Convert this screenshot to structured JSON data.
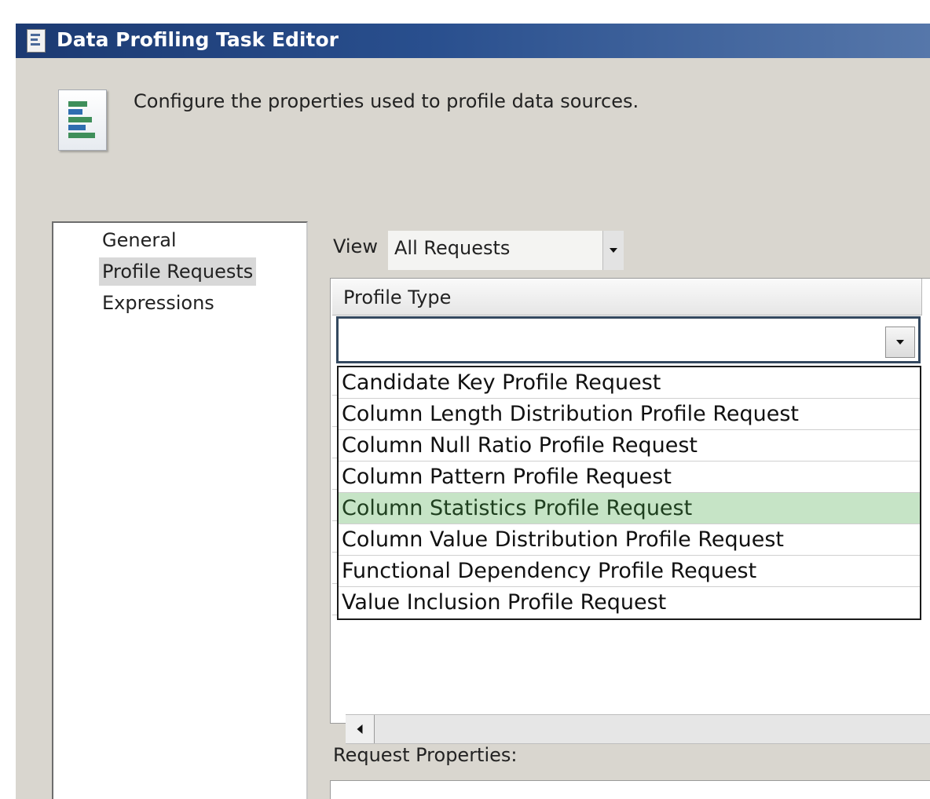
{
  "window": {
    "title": "Data Profiling Task Editor",
    "icon": "document-icon"
  },
  "header": {
    "description": "Configure the properties used to profile data sources.",
    "icon": "data-profile-icon"
  },
  "nav": {
    "items": [
      {
        "label": "General",
        "selected": false
      },
      {
        "label": "Profile Requests",
        "selected": true
      },
      {
        "label": "Expressions",
        "selected": false
      }
    ]
  },
  "view": {
    "label": "View",
    "value": "All Requests"
  },
  "grid": {
    "column_header": "Profile Type",
    "current_value": ""
  },
  "dropdown": {
    "options": [
      "Candidate Key Profile Request",
      "Column Length Distribution Profile Request",
      "Column Null Ratio Profile Request",
      "Column Pattern Profile Request",
      "Column Statistics Profile Request",
      "Column Value Distribution Profile Request",
      "Functional Dependency Profile Request",
      "Value Inclusion Profile Request"
    ],
    "highlighted": "Column Statistics Profile Request"
  },
  "request_properties": {
    "label": "Request Properties:"
  },
  "colors": {
    "titlebar_start": "#1c3a72",
    "titlebar_end": "#5677aa",
    "dialog_background": "#d9d6cf",
    "highlight": "#c6e4c6"
  }
}
